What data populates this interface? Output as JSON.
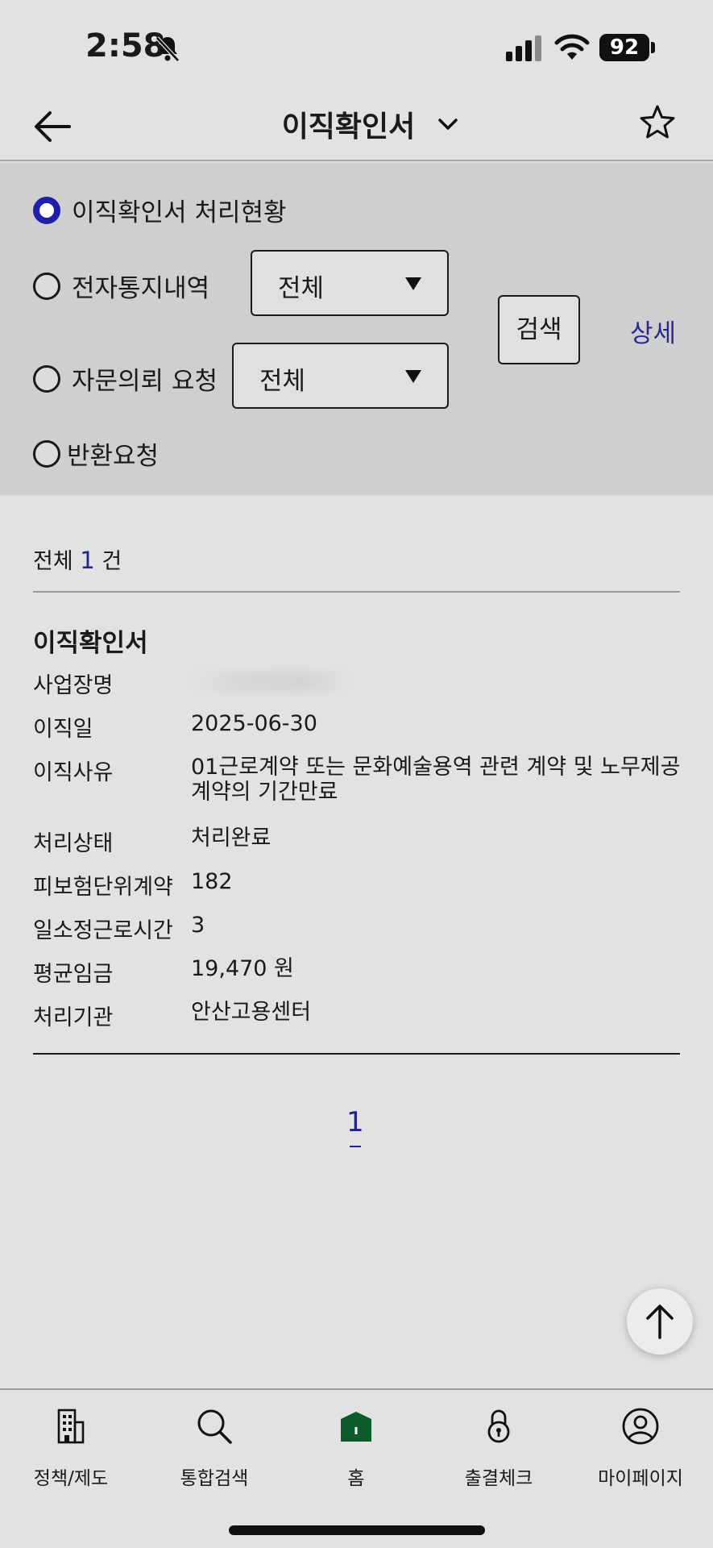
{
  "status_bar": {
    "time": "2:58",
    "battery": "92"
  },
  "header": {
    "title": "이직확인서"
  },
  "filters": {
    "options": [
      {
        "label": "이직확인서 처리현황",
        "checked": true
      },
      {
        "label": "전자통지내역",
        "checked": false,
        "select_value": "전체"
      },
      {
        "label": "자문의뢰 요청",
        "checked": false,
        "select_value": "전체"
      },
      {
        "label": "반환요청",
        "checked": false
      }
    ],
    "search_label": "검색",
    "detail_label": "상세"
  },
  "results": {
    "count_prefix": "전체",
    "count": "1",
    "count_suffix": "건",
    "card": {
      "title": "이직확인서",
      "rows": [
        {
          "label": "사업장명",
          "value": ""
        },
        {
          "label": "이직일",
          "value": "2025-06-30"
        },
        {
          "label": "이직사유",
          "value": "01근로계약 또는 문화예술용역 관련 계약 및 노무제공 계약의 기간만료"
        },
        {
          "label": "처리상태",
          "value": "처리완료"
        },
        {
          "label": "피보험단위계약",
          "value": "182"
        },
        {
          "label": "일소정근로시간",
          "value": "3"
        },
        {
          "label": "평균임금",
          "value": "19,470 원"
        },
        {
          "label": "처리기관",
          "value": "안산고용센터"
        }
      ]
    }
  },
  "pagination": {
    "current": "1"
  },
  "tab_bar": {
    "items": [
      {
        "label": "정책/제도",
        "icon": "building-icon"
      },
      {
        "label": "통합검색",
        "icon": "search-icon"
      },
      {
        "label": "홈",
        "icon": "home-icon"
      },
      {
        "label": "출결체크",
        "icon": "lock-icon"
      },
      {
        "label": "마이페이지",
        "icon": "user-icon"
      }
    ]
  },
  "colors": {
    "accent": "#1f1fa8",
    "link": "#2a2a8c",
    "home_green": "#0d5a2a"
  }
}
